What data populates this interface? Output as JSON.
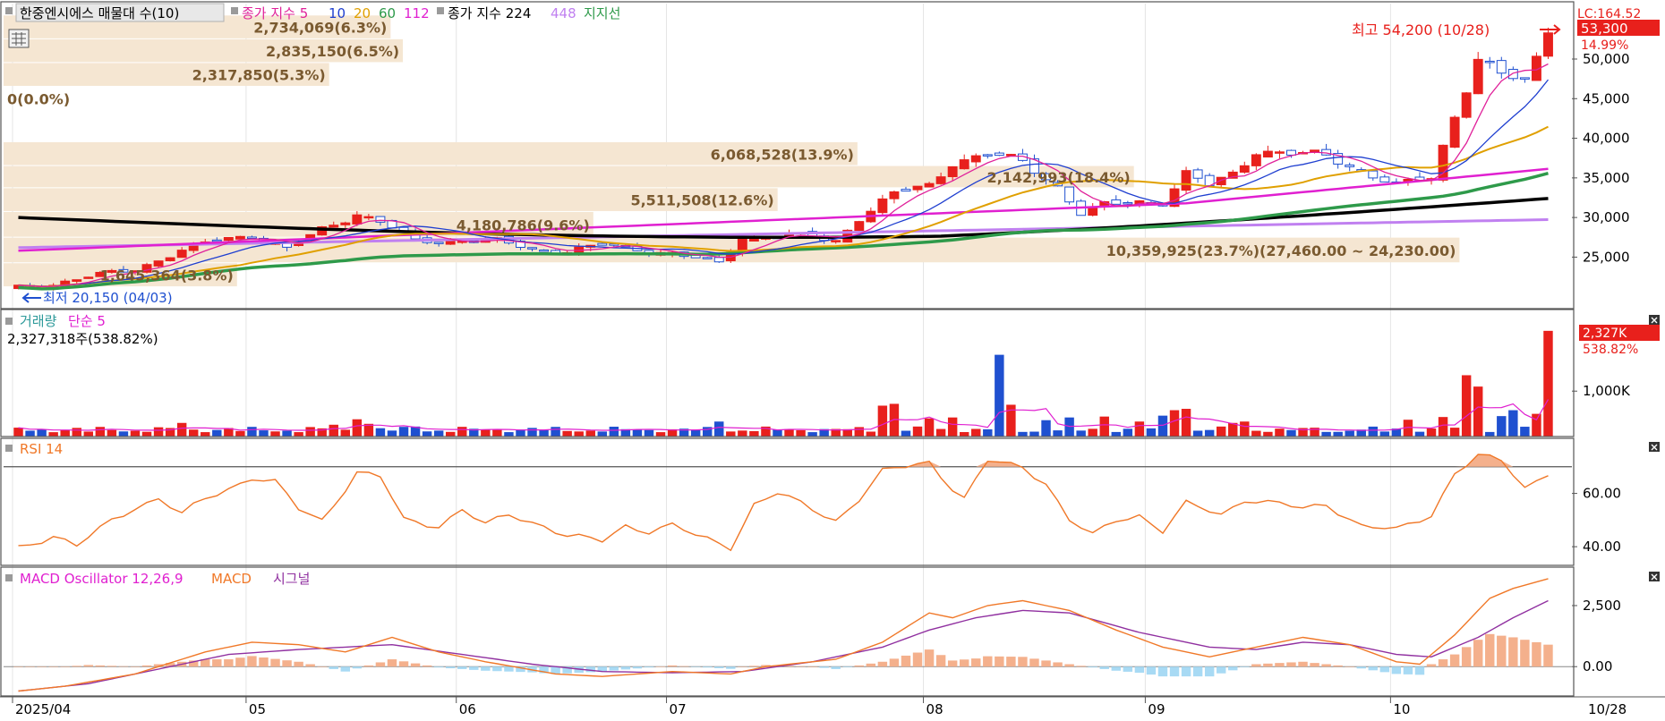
{
  "stock_title": "한중엔시에스 매물대 수(10)",
  "legend_main": [
    {
      "text": "종가 지수 5",
      "color": "#e0219a"
    },
    {
      "text": "10",
      "color": "#1f3fd0"
    },
    {
      "text": "20",
      "color": "#e0a000"
    },
    {
      "text": "60",
      "color": "#2e9a4a"
    },
    {
      "text": "112",
      "color": "#e020d0"
    },
    {
      "text": "종가 지수 224",
      "color": "#000000"
    },
    {
      "text": "448",
      "color": "#c080f0"
    },
    {
      "text": "지지선",
      "color": "#2e9a4a"
    }
  ],
  "lc_label": "LC:164.52",
  "current_price": "53,300",
  "current_pct": "14.99%",
  "high_label": "최고 54,200 (10/28)",
  "low_label": "최저 20,150 (04/03)",
  "last_date": "10/28",
  "colors": {
    "up": "#e8201c",
    "down": "#1f50d0",
    "profile": "#f5e6d2",
    "rsi": "#f07828",
    "macd": "#f07828",
    "signal": "#9030a0",
    "osc_pos": "#f4b08c",
    "osc_neg": "#a8daf4"
  },
  "volume_title": "거래량",
  "volume_ma_label": "단순 5",
  "volume_info": "2,327,318주(538.82%)",
  "volume_badge": "2,327K",
  "volume_badge_pct": "538.82%",
  "rsi_title": "RSI 14",
  "macd_title": "MACD Oscillator 12,26,9",
  "macd_label": "MACD",
  "signal_label": "시그널",
  "chart_data": [
    {
      "type": "candlestick",
      "title": "한중엔시에스",
      "x_months": [
        {
          "label": "2025/04",
          "i": 0
        },
        {
          "label": "05",
          "i": 20
        },
        {
          "label": "06",
          "i": 38
        },
        {
          "label": "07",
          "i": 56
        },
        {
          "label": "08",
          "i": 78
        },
        {
          "label": "09",
          "i": 97
        },
        {
          "label": "10",
          "i": 118
        }
      ],
      "n_points": 132,
      "ylim": [
        18500,
        57000
      ],
      "y_ticks": [
        "25,000",
        "30,000",
        "35,000",
        "40,000",
        "45,000",
        "50,000"
      ],
      "close_anchors": [
        [
          0,
          21200
        ],
        [
          3,
          21600
        ],
        [
          6,
          22500
        ],
        [
          10,
          23500
        ],
        [
          14,
          25800
        ],
        [
          17,
          27200
        ],
        [
          20,
          27800
        ],
        [
          23,
          26000
        ],
        [
          26,
          28500
        ],
        [
          29,
          30500
        ],
        [
          31,
          29500
        ],
        [
          34,
          27000
        ],
        [
          38,
          27200
        ],
        [
          41,
          27000
        ],
        [
          44,
          26000
        ],
        [
          47,
          25800
        ],
        [
          50,
          26500
        ],
        [
          53,
          26000
        ],
        [
          56,
          25500
        ],
        [
          60,
          24200
        ],
        [
          62,
          27500
        ],
        [
          66,
          27800
        ],
        [
          70,
          27000
        ],
        [
          72,
          30000
        ],
        [
          75,
          33000
        ],
        [
          78,
          34000
        ],
        [
          80,
          37000
        ],
        [
          83,
          38000
        ],
        [
          86,
          37000
        ],
        [
          89,
          34000
        ],
        [
          91,
          30500
        ],
        [
          93,
          31500
        ],
        [
          96,
          32000
        ],
        [
          98,
          32000
        ],
        [
          100,
          35500
        ],
        [
          102,
          34000
        ],
        [
          104,
          35500
        ],
        [
          106,
          38500
        ],
        [
          109,
          38000
        ],
        [
          112,
          37800
        ],
        [
          115,
          36000
        ],
        [
          118,
          34000
        ],
        [
          121,
          35000
        ],
        [
          123,
          43000
        ],
        [
          125,
          50000
        ],
        [
          127,
          48000
        ],
        [
          129,
          47000
        ],
        [
          131,
          53300
        ]
      ],
      "ma_last": {
        "ma5": 47500,
        "ma10": 46000,
        "ma20": 43500,
        "ma60": 37500,
        "ma112": 34500,
        "ma224": 32500,
        "ma448": 29800
      },
      "high": 54200,
      "low": 20150,
      "volume_profile": [
        {
          "label": "10,359,925(23.7%)(27,460.00 ~ 24,230.00)",
          "low": 24230,
          "high": 27460,
          "pct": 23.7
        },
        {
          "label": "6,068,528(13.9%)",
          "low": 36500,
          "high": 39500,
          "pct": 13.9
        },
        {
          "label": "5,511,508(12.6%)",
          "low": 30700,
          "high": 33700,
          "pct": 12.6
        },
        {
          "label": "4,180,786(9.6%)",
          "low": 27460,
          "high": 30700,
          "pct": 9.6
        },
        {
          "label": "2,835,150(6.5%)",
          "low": 49500,
          "high": 52500,
          "pct": 6.5
        },
        {
          "label": "2,734,069(6.3%)",
          "low": 52500,
          "high": 55500,
          "pct": 6.3
        },
        {
          "label": "2,317,850(5.3%)",
          "low": 46500,
          "high": 49500,
          "pct": 5.3
        },
        {
          "label": "1,645,364(3.8%)",
          "low": 21200,
          "high": 24230,
          "pct": 3.8
        },
        {
          "label": "2,142,993(18.4%)",
          "low": 33700,
          "high": 36500,
          "pct": 18.4
        },
        {
          "label": "0(0.0%)",
          "low": 43500,
          "high": 46500,
          "pct": 0
        }
      ]
    },
    {
      "type": "bar",
      "title": "거래량",
      "y_ticks": [
        "1,000K"
      ],
      "ylim": [
        0,
        2600000
      ],
      "base_volume": 160000,
      "spikes": [
        [
          14,
          300000
        ],
        [
          27,
          260000
        ],
        [
          29,
          380000
        ],
        [
          30,
          280000
        ],
        [
          34,
          220000
        ],
        [
          44,
          190000
        ],
        [
          60,
          330000
        ],
        [
          74,
          680000
        ],
        [
          75,
          720000
        ],
        [
          78,
          400000
        ],
        [
          80,
          420000
        ],
        [
          84,
          1800000
        ],
        [
          85,
          700000
        ],
        [
          88,
          360000
        ],
        [
          90,
          420000
        ],
        [
          93,
          440000
        ],
        [
          96,
          330000
        ],
        [
          98,
          460000
        ],
        [
          99,
          580000
        ],
        [
          100,
          610000
        ],
        [
          104,
          300000
        ],
        [
          105,
          330000
        ],
        [
          119,
          370000
        ],
        [
          122,
          430000
        ],
        [
          124,
          1350000
        ],
        [
          125,
          1100000
        ],
        [
          127,
          450000
        ],
        [
          128,
          580000
        ],
        [
          130,
          500000
        ],
        [
          131,
          2327318
        ]
      ]
    },
    {
      "type": "line",
      "title": "RSI 14",
      "y_ticks": [
        "40.00",
        "60.00"
      ],
      "ylim": [
        33,
        80
      ],
      "anchors": [
        [
          0,
          40
        ],
        [
          3,
          44
        ],
        [
          5,
          40
        ],
        [
          8,
          50
        ],
        [
          10,
          55
        ],
        [
          12,
          58
        ],
        [
          14,
          52
        ],
        [
          16,
          58
        ],
        [
          18,
          62
        ],
        [
          20,
          66
        ],
        [
          22,
          64
        ],
        [
          24,
          54
        ],
        [
          26,
          50
        ],
        [
          29,
          68
        ],
        [
          31,
          66
        ],
        [
          33,
          50
        ],
        [
          36,
          48
        ],
        [
          38,
          54
        ],
        [
          40,
          48
        ],
        [
          42,
          52
        ],
        [
          45,
          48
        ],
        [
          47,
          44
        ],
        [
          50,
          42
        ],
        [
          52,
          48
        ],
        [
          54,
          46
        ],
        [
          56,
          48
        ],
        [
          58,
          44
        ],
        [
          61,
          40
        ],
        [
          63,
          56
        ],
        [
          65,
          60
        ],
        [
          68,
          54
        ],
        [
          70,
          50
        ],
        [
          72,
          58
        ],
        [
          74,
          68
        ],
        [
          76,
          70
        ],
        [
          78,
          72
        ],
        [
          80,
          62
        ],
        [
          81,
          58
        ],
        [
          83,
          72
        ],
        [
          86,
          70
        ],
        [
          88,
          64
        ],
        [
          90,
          50
        ],
        [
          92,
          44
        ],
        [
          94,
          50
        ],
        [
          96,
          52
        ],
        [
          98,
          46
        ],
        [
          100,
          56
        ],
        [
          103,
          52
        ],
        [
          105,
          58
        ],
        [
          108,
          56
        ],
        [
          110,
          54
        ],
        [
          112,
          56
        ],
        [
          115,
          48
        ],
        [
          118,
          46
        ],
        [
          121,
          52
        ],
        [
          123,
          68
        ],
        [
          125,
          74
        ],
        [
          127,
          72
        ],
        [
          129,
          62
        ],
        [
          131,
          68
        ]
      ]
    },
    {
      "type": "line",
      "title": "MACD Oscillator 12,26,9",
      "y_ticks": [
        "0.00",
        "2,500"
      ],
      "ylim": [
        -1200,
        4000
      ],
      "macd_anchors": [
        [
          0,
          -1000
        ],
        [
          4,
          -800
        ],
        [
          10,
          -300
        ],
        [
          16,
          600
        ],
        [
          20,
          1000
        ],
        [
          24,
          900
        ],
        [
          28,
          600
        ],
        [
          32,
          1200
        ],
        [
          36,
          600
        ],
        [
          40,
          200
        ],
        [
          46,
          -300
        ],
        [
          50,
          -400
        ],
        [
          56,
          -200
        ],
        [
          61,
          -300
        ],
        [
          64,
          0
        ],
        [
          70,
          300
        ],
        [
          74,
          1000
        ],
        [
          78,
          2200
        ],
        [
          80,
          2000
        ],
        [
          83,
          2500
        ],
        [
          86,
          2700
        ],
        [
          90,
          2300
        ],
        [
          94,
          1500
        ],
        [
          98,
          800
        ],
        [
          102,
          400
        ],
        [
          106,
          800
        ],
        [
          110,
          1200
        ],
        [
          114,
          900
        ],
        [
          118,
          200
        ],
        [
          120,
          100
        ],
        [
          123,
          1300
        ],
        [
          126,
          2800
        ],
        [
          128,
          3200
        ],
        [
          131,
          3600
        ]
      ],
      "signal_anchors": [
        [
          0,
          -1000
        ],
        [
          6,
          -700
        ],
        [
          12,
          -100
        ],
        [
          18,
          500
        ],
        [
          24,
          700
        ],
        [
          28,
          800
        ],
        [
          32,
          900
        ],
        [
          38,
          500
        ],
        [
          44,
          100
        ],
        [
          50,
          -200
        ],
        [
          56,
          -250
        ],
        [
          62,
          -200
        ],
        [
          68,
          200
        ],
        [
          74,
          800
        ],
        [
          78,
          1500
        ],
        [
          82,
          2000
        ],
        [
          86,
          2300
        ],
        [
          90,
          2200
        ],
        [
          96,
          1400
        ],
        [
          102,
          800
        ],
        [
          106,
          700
        ],
        [
          110,
          1000
        ],
        [
          114,
          900
        ],
        [
          118,
          500
        ],
        [
          121,
          400
        ],
        [
          125,
          1200
        ],
        [
          128,
          2000
        ],
        [
          131,
          2700
        ]
      ]
    }
  ]
}
